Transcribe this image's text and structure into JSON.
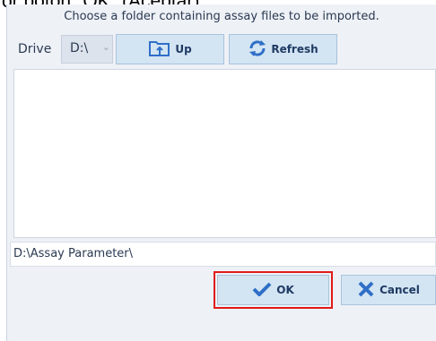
{
  "caption": "or botón \"OK\" (Aceptar).",
  "dialog": {
    "instruction": "Choose a folder containing assay files to be imported.",
    "drive_label": "Drive",
    "drive_value": "D:\\",
    "up_label": "Up",
    "refresh_label": "Refresh",
    "path": "D:\\Assay Parameter\\",
    "ok_label": "OK",
    "cancel_label": "Cancel"
  },
  "colors": {
    "button_bg": "#d3e4f3",
    "accent_icon": "#2f6fc7",
    "highlight": "#e01a1a"
  }
}
